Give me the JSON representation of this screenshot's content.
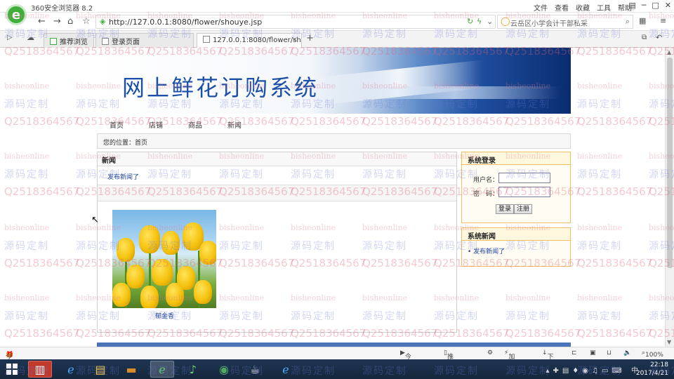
{
  "browser": {
    "app_title": "360安全浏览器 8.2",
    "menu": [
      "文件",
      "查看",
      "收藏",
      "工具",
      "帮助"
    ],
    "url": "http://127.0.0.1:8080/flower/shouye.jsp",
    "search_text": "云岳区小学会计干部私采",
    "tabs": [
      {
        "label": "推荐浏览"
      },
      {
        "label": "登录页面"
      },
      {
        "label": "127.0.0.1:8080/flower/shouye.jsp"
      }
    ],
    "new_tab": "+"
  },
  "site": {
    "title": "网上鲜花订购系统",
    "nav": [
      "首页",
      "店铺",
      "商品",
      "新闻"
    ],
    "breadcrumb": "您的位置：首页",
    "news": {
      "heading": "新闻",
      "item": "发布新闻了"
    },
    "product": {
      "name": "郁金香"
    },
    "login": {
      "heading": "系统登录",
      "username_label": "用户名：",
      "password_label": "密　码：",
      "login_btn": "登录",
      "register_btn": "注册"
    },
    "sys_news": {
      "heading": "系统新闻",
      "item": "发布新闻了"
    }
  },
  "watermarks": {
    "a": "bisheonline",
    "b": "源码定制",
    "c": "Q2518364567"
  },
  "statusbar": {
    "left": "今日优选",
    "live": "今日直播",
    "recommend": "推荐浏览",
    "accelerate": "加速器",
    "download": "下载",
    "zoom": "100%"
  },
  "taskbar": {
    "time": "22:18",
    "date": "2017/4/21"
  }
}
